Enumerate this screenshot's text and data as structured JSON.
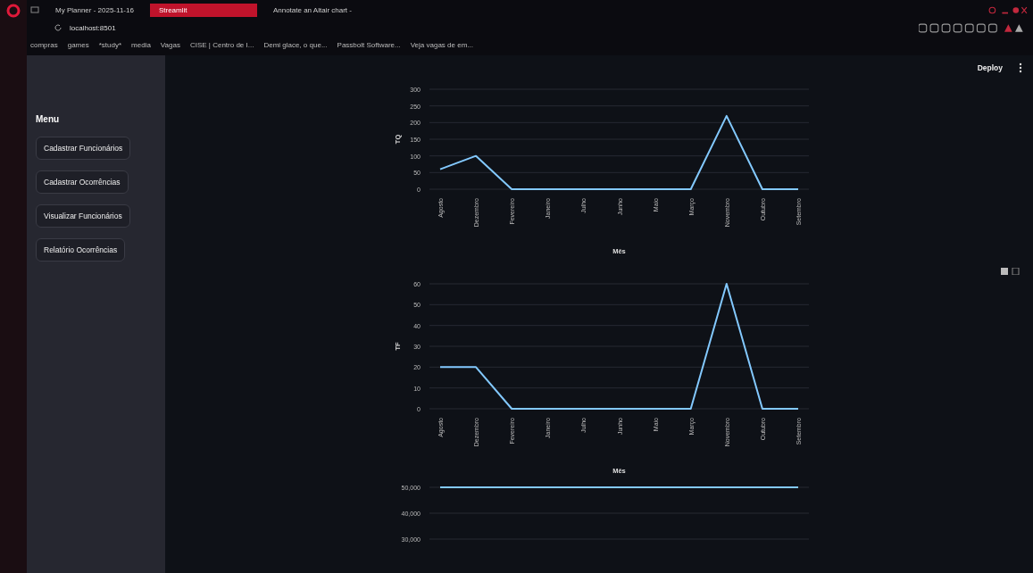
{
  "browser": {
    "tabs": [
      {
        "title": "My Planner - 2025-11-16",
        "selected": false
      },
      {
        "title": "Streamlit",
        "selected": true
      },
      {
        "title": "Annotate an Altair chart -",
        "selected": false
      }
    ],
    "url": "localhost:8501",
    "bookmarks": [
      "compras",
      "games",
      "*study*",
      "media",
      "Vagas",
      "CISE | Centro de I...",
      "Demi glace, o que...",
      "Passbolt Software...",
      "Veja vagas de em..."
    ]
  },
  "app": {
    "deploy": "Deploy",
    "menu_title": "Menu",
    "menu_buttons": [
      "Cadastrar Funcionários",
      "Cadastrar Ocorrências",
      "Visualizar Funcionários",
      "Relatório Ocorrências"
    ],
    "charts": [
      {
        "chart_data": {
          "type": "line",
          "xlabel": "Mês",
          "ylabel": "TQ",
          "categories": [
            "Agosto",
            "Dezembro",
            "Fevereiro",
            "Janeiro",
            "Julho",
            "Junho",
            "Maio",
            "Março",
            "Novembro",
            "Outubro",
            "Setembro"
          ],
          "ylim": [
            0,
            300
          ],
          "yticks": [
            0,
            50,
            100,
            150,
            200,
            250,
            300
          ],
          "grid": true,
          "series": [
            {
              "color": "#83c9ff",
              "values": [
                60,
                100,
                0,
                0,
                0,
                0,
                0,
                0,
                220,
                0,
                0
              ]
            }
          ]
        }
      },
      {
        "chart_data": {
          "type": "line",
          "xlabel": "Mês",
          "ylabel": "TF",
          "categories": [
            "Agosto",
            "Dezembro",
            "Fevereiro",
            "Janeiro",
            "Julho",
            "Junho",
            "Maio",
            "Março",
            "Novembro",
            "Outubro",
            "Setembro"
          ],
          "ylim": [
            0,
            60
          ],
          "yticks": [
            0,
            10,
            20,
            30,
            40,
            50,
            60
          ],
          "grid": true,
          "series": [
            {
              "color": "#83c9ff",
              "values": [
                20,
                20,
                0,
                0,
                0,
                0,
                0,
                0,
                60,
                0,
                0
              ]
            }
          ]
        }
      },
      {
        "chart_data": {
          "type": "line",
          "ylim": [
            30000,
            50000
          ],
          "yticks": [
            {
              "value": 30000,
              "label": "30,000"
            },
            {
              "value": 40000,
              "label": "40,000"
            },
            {
              "value": 50000,
              "label": "50,000"
            }
          ],
          "grid": true,
          "series": [
            {
              "color": "#83c9ff",
              "values": [
                50000,
                50000,
                50000,
                50000,
                50000,
                50000,
                50000,
                50000,
                50000,
                50000,
                50000
              ]
            }
          ]
        }
      }
    ]
  }
}
